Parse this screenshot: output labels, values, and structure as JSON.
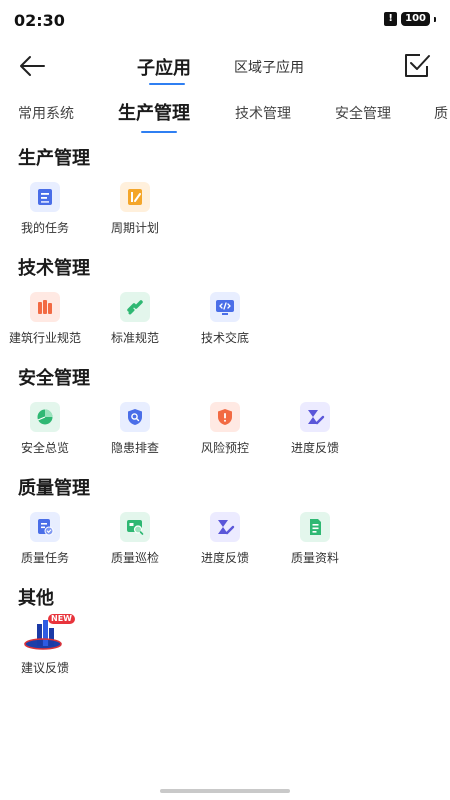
{
  "status": {
    "time": "02:30",
    "battery": "100",
    "alert": "!"
  },
  "nav": {
    "active_tab": "子应用",
    "inactive_tab": "区域子应用"
  },
  "categories": [
    "常用系统",
    "生产管理",
    "技术管理",
    "安全管理",
    "质"
  ],
  "sections": [
    {
      "title": "生产管理",
      "items": [
        {
          "label": "我的任务",
          "icon": "task-icon"
        },
        {
          "label": "周期计划",
          "icon": "plan-icon"
        }
      ]
    },
    {
      "title": "技术管理",
      "items": [
        {
          "label": "建筑行业规范",
          "icon": "building-standard-icon"
        },
        {
          "label": "标准规范",
          "icon": "standard-icon"
        },
        {
          "label": "技术交底",
          "icon": "code-icon"
        }
      ]
    },
    {
      "title": "安全管理",
      "items": [
        {
          "label": "安全总览",
          "icon": "pie-chart-icon"
        },
        {
          "label": "隐患排查",
          "icon": "shield-search-icon"
        },
        {
          "label": "风险预控",
          "icon": "warning-shield-icon"
        },
        {
          "label": "进度反馈",
          "icon": "progress-icon"
        }
      ]
    },
    {
      "title": "质量管理",
      "items": [
        {
          "label": "质量任务",
          "icon": "quality-task-icon"
        },
        {
          "label": "质量巡检",
          "icon": "inspection-icon"
        },
        {
          "label": "进度反馈",
          "icon": "progress-icon"
        },
        {
          "label": "质量资料",
          "icon": "document-icon"
        }
      ]
    },
    {
      "title": "其他",
      "items": [
        {
          "label": "建议反馈",
          "icon": "feedback-building-icon",
          "badge": "NEW"
        }
      ]
    }
  ],
  "colors": {
    "accent": "#2f7ff2",
    "blue_bg": "#e8eeff",
    "blue": "#4a6ee8",
    "orange_bg": "#fff0dc",
    "orange": "#f4a62a",
    "red_bg": "#ffe9e3",
    "red": "#f26a43",
    "green_bg": "#e3f6ec",
    "green": "#2fb873",
    "purple_bg": "#ecebff",
    "purple": "#5b57d9"
  }
}
